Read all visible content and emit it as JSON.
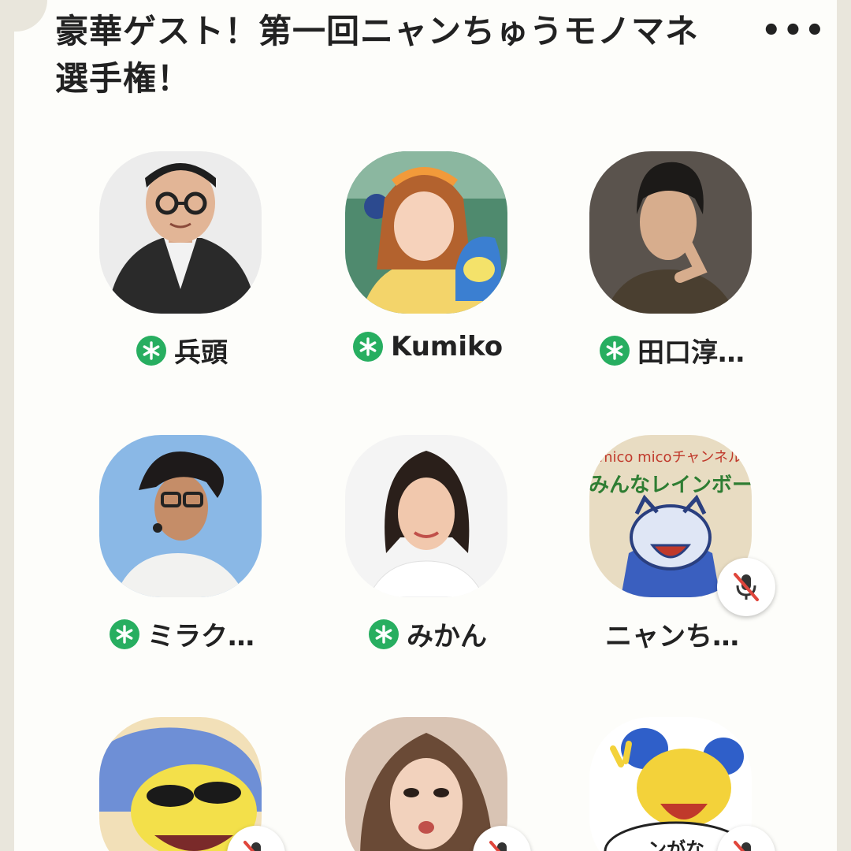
{
  "room": {
    "title": "豪華ゲスト！第一回ニャンちゅうモノマネ選手権！",
    "more_label": "•••"
  },
  "speakers": [
    {
      "name": "兵頭",
      "moderator": true,
      "muted": false
    },
    {
      "name": "Kumiko",
      "moderator": true,
      "muted": false
    },
    {
      "name": "田口淳…",
      "moderator": true,
      "muted": false
    },
    {
      "name": "ミラク…",
      "moderator": true,
      "muted": false
    },
    {
      "name": "みかん",
      "moderator": true,
      "muted": false
    },
    {
      "name": "ニャンち…",
      "moderator": false,
      "muted": true,
      "avatar_text": [
        "mico micoチャンネル",
        "みんなレインボー"
      ]
    },
    {
      "name": "",
      "moderator": false,
      "muted": true
    },
    {
      "name": "",
      "moderator": false,
      "muted": true
    },
    {
      "name": "",
      "moderator": false,
      "muted": true,
      "avatar_text": [
        "ンがな"
      ]
    }
  ],
  "colors": {
    "moderator_badge": "#27ae60",
    "mute_slash": "#e0463c",
    "background": "#fdfdfa"
  },
  "icons": {
    "moderator": "asterisk-icon",
    "muted": "microphone-off-icon",
    "more": "ellipsis-icon"
  }
}
